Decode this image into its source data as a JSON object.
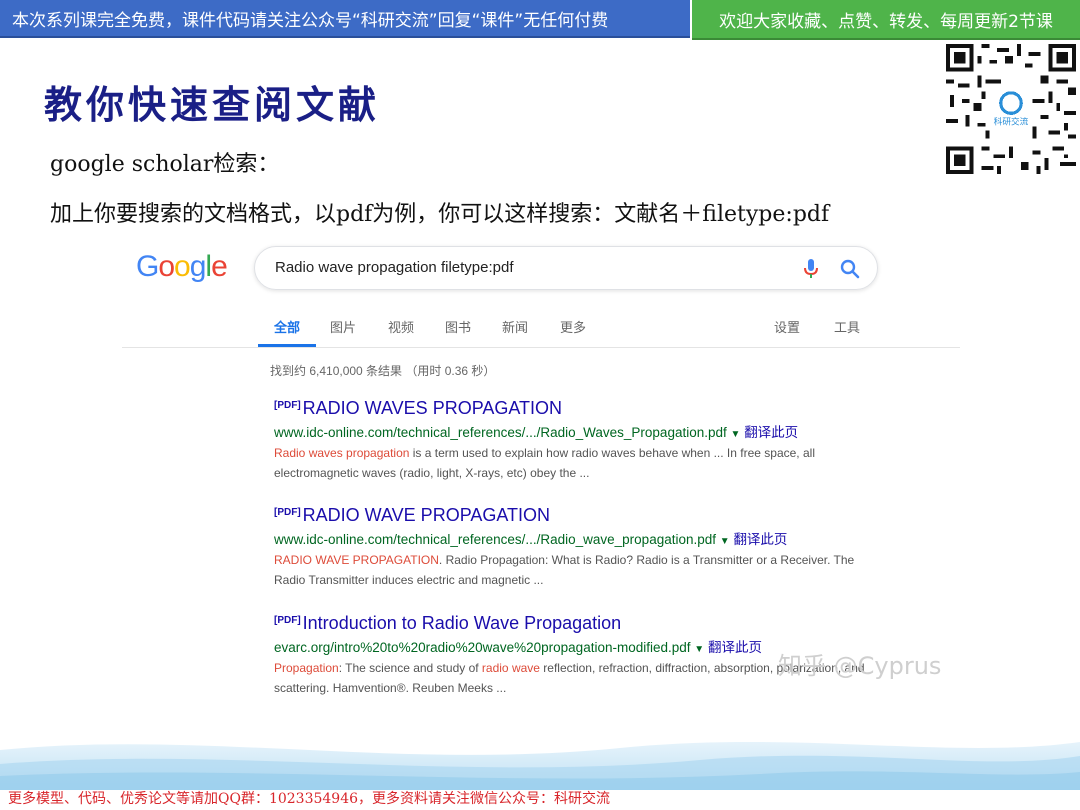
{
  "banner": {
    "left_text": "本次系列课完全免费，课件代码请关注公众号“科研交流”回复“课件”无任何付费",
    "right_text": "欢迎大家收藏、点赞、转发、每周更新2节课"
  },
  "slide": {
    "title": "教你快速查阅文献",
    "subtitle": "google scholar检索：",
    "instruction": "加上你要搜索的文档格式，以pdf为例，你可以这样搜索：文献名＋filetype:pdf"
  },
  "google": {
    "logo": [
      "G",
      "o",
      "o",
      "g",
      "l",
      "e"
    ],
    "logo_colors": [
      "#4285f4",
      "#ea4335",
      "#fbbc05",
      "#4285f4",
      "#34a853",
      "#ea4335"
    ],
    "query": "Radio wave propagation filetype:pdf",
    "tabs": [
      "全部",
      "图片",
      "视频",
      "图书",
      "新闻",
      "更多"
    ],
    "right_tabs": [
      "设置",
      "工具"
    ],
    "result_count": "找到约 6,410,000 条结果 （用时 0.36 秒）",
    "results": [
      {
        "tag": "[PDF]",
        "title": "RADIO WAVES PROPAGATION",
        "url": "www.idc-online.com/technical_references/.../Radio_Waves_Propagation.pdf",
        "translate": "翻译此页",
        "snippet_hl": "Radio waves propagation",
        "snippet_rest": " is a term used to explain how radio waves behave when ... In free space, all electromagnetic waves (radio, light, X-rays, etc) obey the ..."
      },
      {
        "tag": "[PDF]",
        "title": "RADIO WAVE PROPAGATION",
        "url": "www.idc-online.com/technical_references/.../Radio_wave_propagation.pdf",
        "translate": "翻译此页",
        "snippet_hl": "RADIO WAVE PROPAGATION",
        "snippet_rest": ". Radio Propagation: What is Radio? Radio is a Transmitter or a Receiver. The Radio Transmitter induces electric and magnetic ..."
      },
      {
        "tag": "[PDF]",
        "title": "Introduction to Radio Wave Propagation",
        "url": "evarc.org/intro%20to%20radio%20wave%20propagation-modified.pdf",
        "translate": "翻译此页",
        "snippet_hl": "Propagation",
        "snippet_rest": ": The science and study of ",
        "snippet_hl2": "radio wave",
        "snippet_rest2": " reflection, refraction, diffraction, absorption, polarization, and scattering. Hamvention®. Reuben Meeks ..."
      }
    ]
  },
  "watermark": "知乎 @Cyprus",
  "qr_label": "科研交流",
  "footer": "更多模型、代码、优秀论文等请加QQ群：1023354946，更多资料请关注微信公众号：科研交流"
}
